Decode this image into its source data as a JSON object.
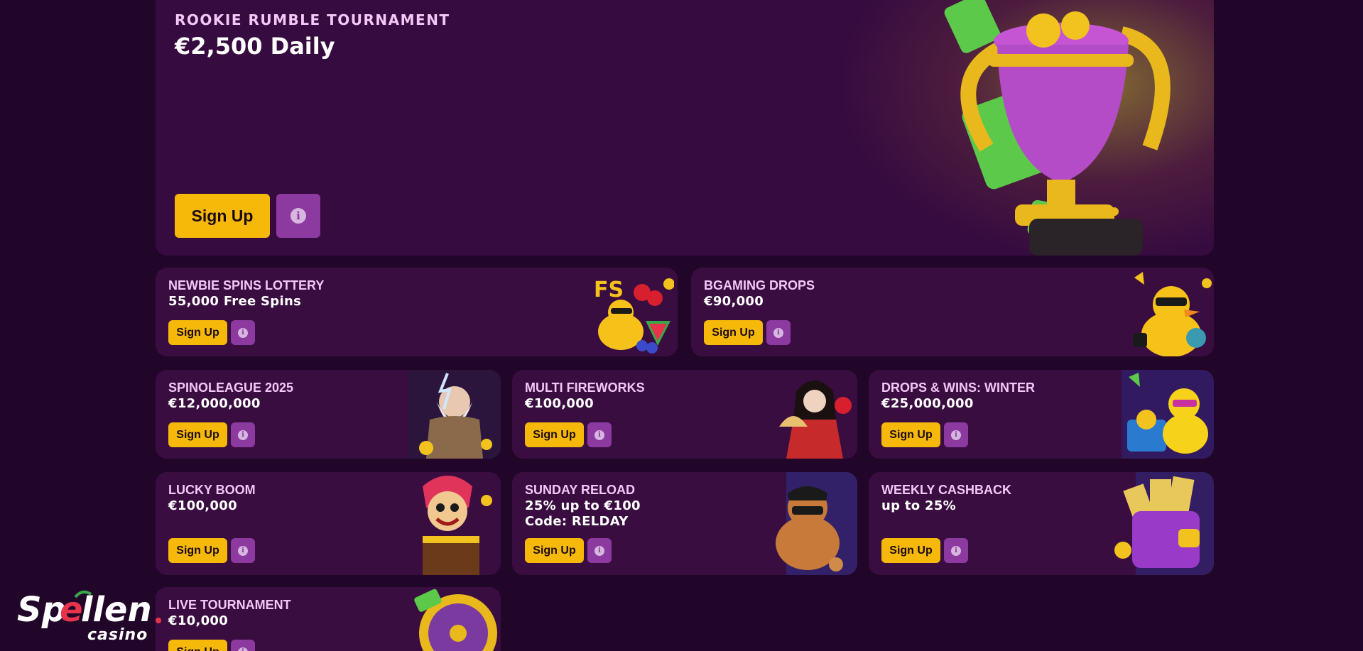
{
  "hero": {
    "subtitle": "ROOKIE RUMBLE TOURNAMENT",
    "title": "€2,500 Daily",
    "signup_label": "Sign Up",
    "info_icon": "info-icon",
    "accent": "#f6b90a"
  },
  "promos": [
    {
      "subtitle": "NEWBIE SPINS LOTTERY",
      "title": "55,000 Free Spins",
      "signup_label": "Sign Up",
      "art": "fs-duck-fruit-art"
    },
    {
      "subtitle": "BGAMING DROPS",
      "title": "€90,000",
      "signup_label": "Sign Up",
      "art": "duck-sunglasses-art"
    },
    {
      "subtitle": "SPINOLEAGUE 2025",
      "title": "€12,000,000",
      "signup_label": "Sign Up",
      "art": "zeus-art"
    },
    {
      "subtitle": "MULTI FIREWORKS",
      "title": "€100,000",
      "signup_label": "Sign Up",
      "art": "geisha-fan-art"
    },
    {
      "subtitle": "DROPS & WINS: WINTER",
      "title": "€25,000,000",
      "signup_label": "Sign Up",
      "art": "duck-treasure-art"
    },
    {
      "subtitle": "LUCKY BOOM",
      "title": "€100,000",
      "signup_label": "Sign Up",
      "art": "jester-box-art"
    },
    {
      "subtitle": "SUNDAY RELOAD",
      "title": "25% up to €100\nCode: RELDAY",
      "signup_label": "Sign Up",
      "art": "gold-duck-art"
    },
    {
      "subtitle": "WEEKLY CASHBACK",
      "title": "up to 25%",
      "signup_label": "Sign Up",
      "art": "wallet-cash-art"
    },
    {
      "subtitle": "LIVE TOURNAMENT",
      "title": "€10,000",
      "signup_label": "Sign Up",
      "art": "roulette-art"
    }
  ],
  "logo": {
    "text_main": "Spellen",
    "text_sub": "casino"
  },
  "colors": {
    "background": "#22062a",
    "card": "#3a0d40",
    "button": "#f6b90a",
    "info_button": "#8c3aa0",
    "subtitle_text": "#f3c8f6"
  }
}
